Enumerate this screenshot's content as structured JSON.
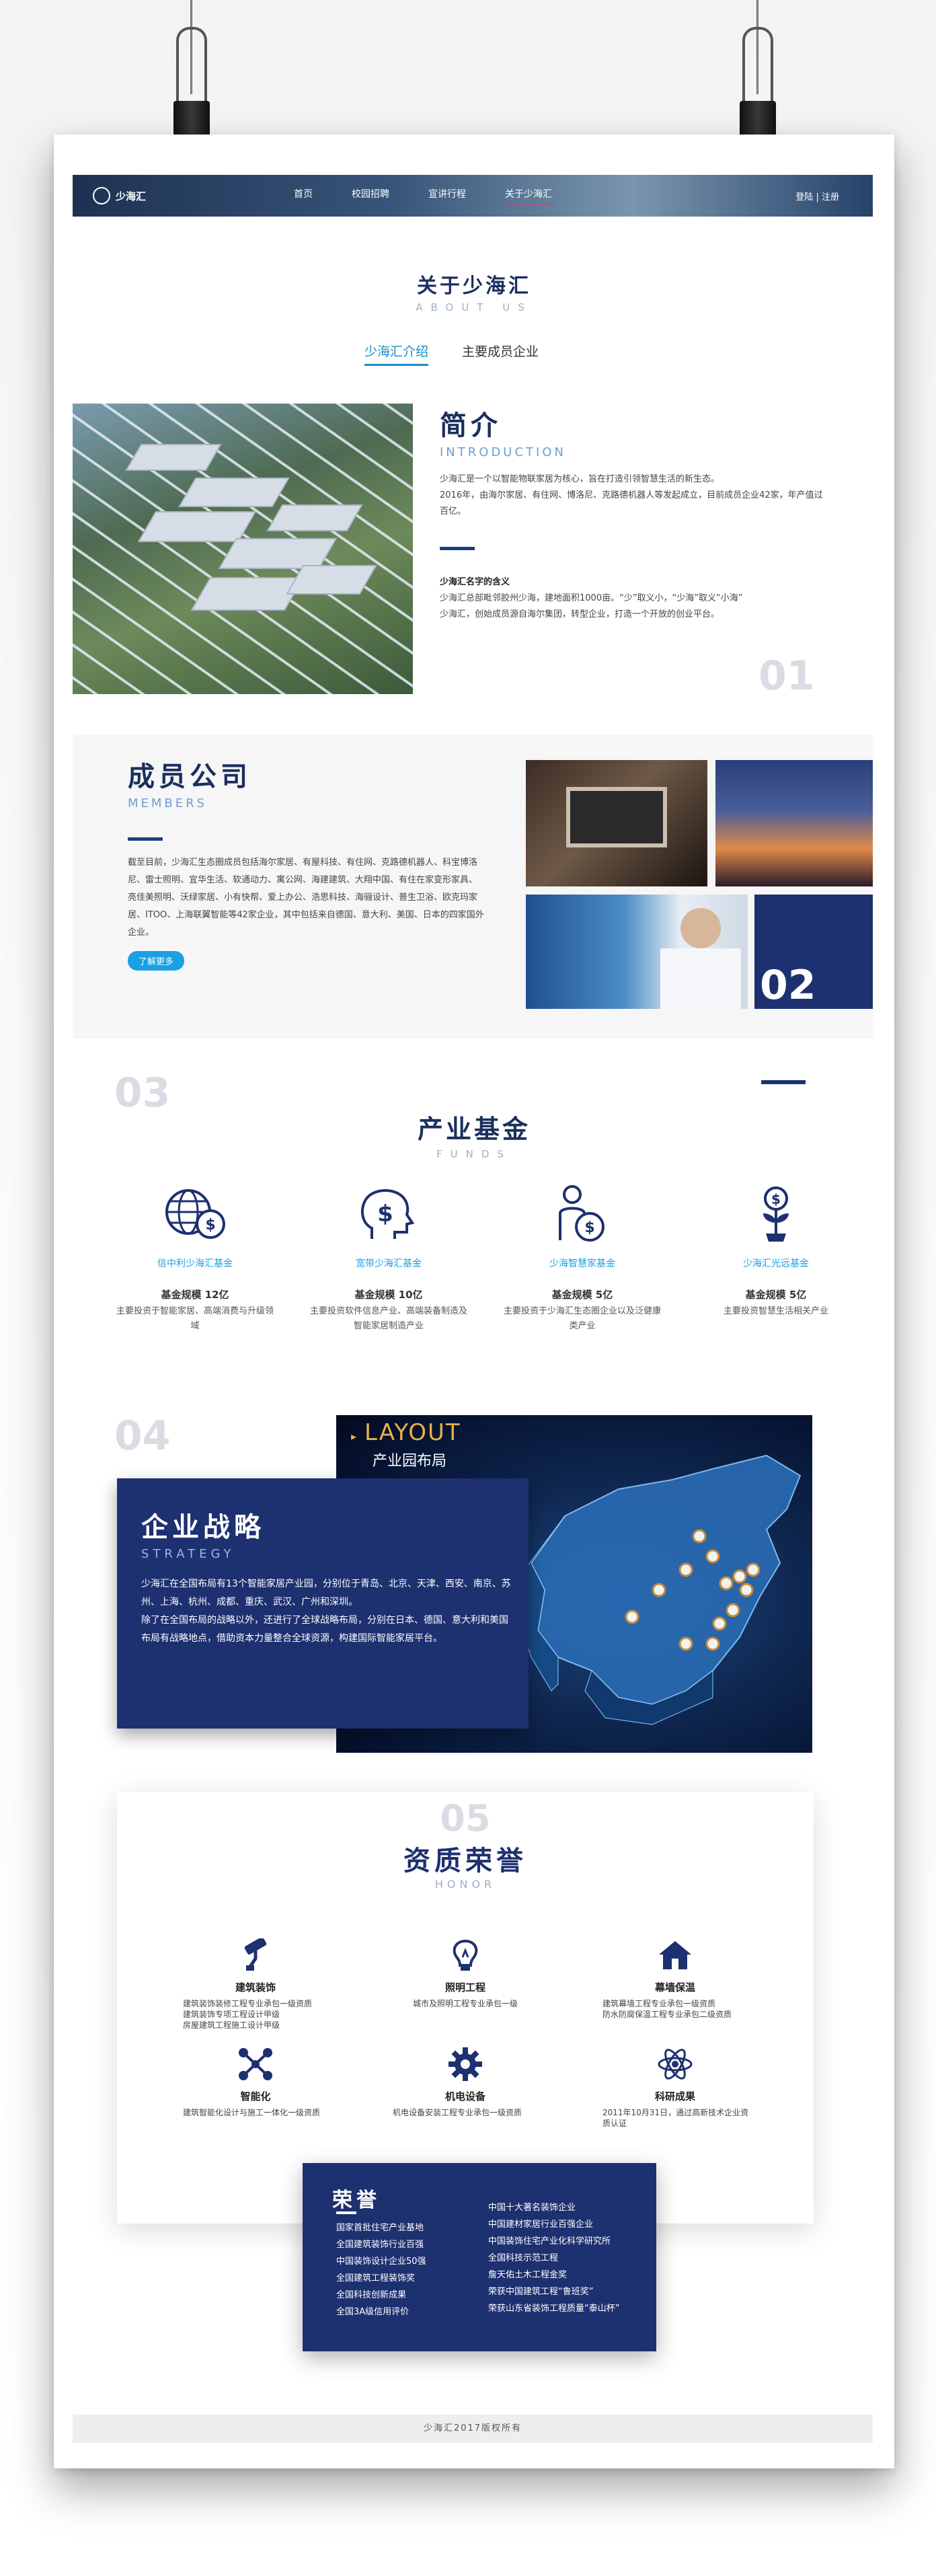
{
  "nav": {
    "logo_text": "少海汇",
    "links": [
      "首页",
      "校园招聘",
      "宣讲行程",
      "关于少海汇"
    ],
    "login": "登陆",
    "divider": "|",
    "register": "注册"
  },
  "about": {
    "title": "关于少海汇",
    "subtitle": "ABOUT US"
  },
  "tabs": [
    "少海汇介绍",
    "主要成员企业"
  ],
  "intro": {
    "title": "简介",
    "subtitle": "INTRODUCTION",
    "p1": "少海汇是一个以智能物联家居为核心，旨在打造引领智慧生活的新生态。",
    "p2": "2016年，由海尔家居、有住网、博洛尼、克路德机器人等发起成立，目前成员企业42家，年产值过百亿。",
    "name_title": "少海汇名字的含义",
    "name_p1": "少海汇总部毗邻胶州少海，建地面积1000亩。“少”取义小，“少海”取义“小海”",
    "name_p2": "少海汇，创始成员源自海尔集团，转型企业，打造一个开放的创业平台。",
    "num": "01"
  },
  "members": {
    "title": "成员公司",
    "subtitle": "MEMBERS",
    "text": "截至目前，少海汇生态圈成员包括海尔家居、有屋科技、有住网、克路德机器人、科宝博洛尼、雷士照明、宜华生活、软通动力、寓公网、海建建筑、大翔中国、有住在家变形家具、亮佳美照明、沃绿家居、小有快帮、爱上办公、浩思科技、海骊设计、普生卫浴、欧克玛家居、ITOO、上海联翼智能等42家企业，其中包括来自德国、意大利、美国、日本的四家国外企业。",
    "more": "了解更多",
    "num": "02"
  },
  "funds": {
    "num": "03",
    "title": "产业基金",
    "subtitle": "FUNDS",
    "items": [
      {
        "icon": "globe-dollar-icon",
        "name": "信中利少海汇基金",
        "scale": "基金规模 12亿",
        "desc": "主要投资于智能家居、高端消费与升级领域"
      },
      {
        "icon": "head-dollar-icon",
        "name": "宽带少海汇基金",
        "scale": "基金规模 10亿",
        "desc": "主要投资软件信息产业、高端装备制造及智能家居制造产业"
      },
      {
        "icon": "person-dollar-icon",
        "name": "少海智慧家基金",
        "scale": "基金规模 5亿",
        "desc": "主要投资于少海汇生态圈企业以及泛健康类产业"
      },
      {
        "icon": "plant-dollar-icon",
        "name": "少海汇光远基金",
        "scale": "基金规模 5亿",
        "desc": "主要投资智慧生活相关产业"
      }
    ]
  },
  "strategy": {
    "num": "04",
    "layout_en": "LAYOUT",
    "layout_cn": "产业园布局",
    "title": "企业战略",
    "subtitle": "STRATEGY",
    "p1": "少海汇在全国布局有13个智能家居产业园，分别位于青岛、北京、天津、西安、南京、苏州、上海、杭州、成都、重庆、武汉、广州和深圳。",
    "p2": "除了在全国布局的战略以外，还进行了全球战略布局，分别在日本、德国、意大利和美国布局有战略地点，借助资本力量整合全球资源，构建国际智能家居平台。"
  },
  "qualification": {
    "num": "05",
    "title": "资质荣誉",
    "subtitle": "HONOR",
    "items": [
      {
        "icon": "paint-roller-icon",
        "name": "建筑装饰",
        "lines": [
          "建筑装饰装修工程专业承包一级资质",
          "建筑装饰专项工程设计甲级",
          "房屋建筑工程施工设计甲级"
        ]
      },
      {
        "icon": "light-bulb-icon",
        "name": "照明工程",
        "lines": [
          "城市及照明工程专业承包一级"
        ]
      },
      {
        "icon": "house-icon",
        "name": "幕墙保温",
        "lines": [
          "建筑幕墙工程专业承包一级资质",
          "防水防腐保温工程专业承包二级资质"
        ]
      },
      {
        "icon": "network-icon",
        "name": "智能化",
        "lines": [
          "建筑智能化设计与施工一体化一级资质"
        ]
      },
      {
        "icon": "gear-icon",
        "name": "机电设备",
        "lines": [
          "机电设备安装工程专业承包一级资质"
        ]
      },
      {
        "icon": "atom-icon",
        "name": "科研成果",
        "lines": [
          "2011年10月31日，通过高新技术企业资质认证"
        ]
      }
    ]
  },
  "honor": {
    "title": "荣誉",
    "left": [
      "国家首批住宅产业基地",
      "全国建筑装饰行业百强",
      "中国装饰设计企业50强",
      "全国建筑工程装饰奖",
      "全国科技创新成果",
      "全国3A级信用评价"
    ],
    "right": [
      "中国十大著名装饰企业",
      "中国建材家居行业百强企业",
      "中国装饰住宅产业化科学研究所",
      "全国科技示范工程",
      "詹天佑土木工程金奖",
      "荣获中国建筑工程“鲁班奖”",
      "荣获山东省装饰工程质量“泰山杯”"
    ]
  },
  "footer": {
    "text": "少海汇2017版权所有"
  },
  "colors": {
    "navy": "#1d3070",
    "accent": "#1aa0e3",
    "active_tab_line": "#e23b7a"
  }
}
